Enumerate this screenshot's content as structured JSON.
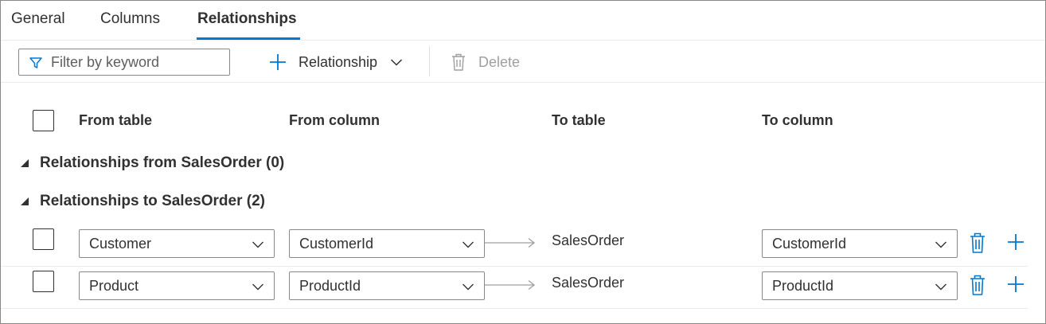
{
  "tabs": [
    {
      "label": "General",
      "active": false
    },
    {
      "label": "Columns",
      "active": false
    },
    {
      "label": "Relationships",
      "active": true
    }
  ],
  "toolbar": {
    "filter_placeholder": "Filter by keyword",
    "relationship_label": "Relationship",
    "delete_label": "Delete"
  },
  "table": {
    "columns": [
      "From table",
      "From column",
      "To table",
      "To column"
    ]
  },
  "groups": [
    {
      "label": "Relationships from SalesOrder (0)"
    },
    {
      "label": "Relationships to SalesOrder (2)"
    }
  ],
  "rows": [
    {
      "from_table": "Customer",
      "from_column": "CustomerId",
      "to_table": "SalesOrder",
      "to_column": "CustomerId"
    },
    {
      "from_table": "Product",
      "from_column": "ProductId",
      "to_table": "SalesOrder",
      "to_column": "ProductId"
    }
  ],
  "colors": {
    "accent": "#0078d4",
    "text": "#323130",
    "disabled": "#a19f9d",
    "border": "#8a8886"
  },
  "icons": [
    "filter-icon",
    "plus-icon",
    "chevron-down-icon",
    "trash-icon",
    "arrow-right-icon",
    "caret-down-icon"
  ]
}
